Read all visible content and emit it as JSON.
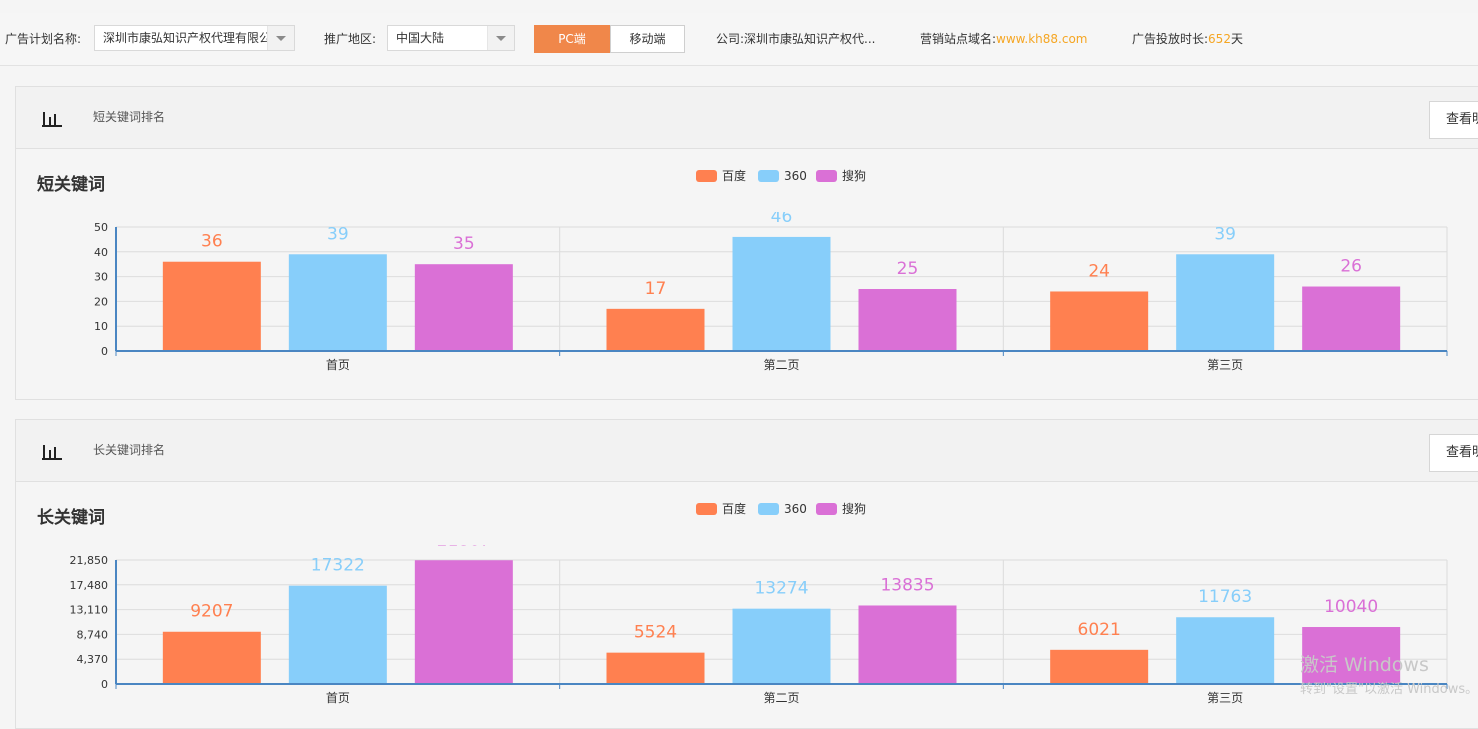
{
  "filters": {
    "plan_label": "广告计划名称:",
    "plan_value": "深圳市康弘知识产权代理有限公司",
    "region_label": "推广地区:",
    "region_value": "中国大陆",
    "device_pc": "PC端",
    "device_mobile": "移动端",
    "company_label": "公司:",
    "company_value": "深圳市康弘知识产权代...",
    "domain_label": "营销站点域名:",
    "domain_value": "www.kh88.com",
    "duration_label": "广告投放时长:",
    "duration_value": "652",
    "duration_unit": "天"
  },
  "panels": [
    {
      "title": "短关键词排名",
      "button": "查看明细",
      "chart_title": "短关键词"
    },
    {
      "title": "长关键词排名",
      "button": "查看明细",
      "chart_title": "长关键词"
    }
  ],
  "colors": {
    "baidu": "#ff8050",
    "s360": "#87cefa",
    "sogou": "#da70d6",
    "accent": "#f0874a"
  },
  "chart_data": [
    {
      "type": "bar",
      "categories": [
        "首页",
        "第二页",
        "第三页"
      ],
      "series": [
        {
          "name": "百度",
          "values": [
            36,
            17,
            24
          ]
        },
        {
          "name": "360",
          "values": [
            39,
            46,
            39
          ]
        },
        {
          "name": "搜狗",
          "values": [
            35,
            25,
            26
          ]
        }
      ],
      "yticks": [
        "0",
        "10",
        "20",
        "30",
        "40",
        "50"
      ],
      "ylim": [
        0,
        50
      ],
      "legend": "top-center",
      "grid": true
    },
    {
      "type": "bar",
      "categories": [
        "首页",
        "第二页",
        "第三页"
      ],
      "series": [
        {
          "name": "百度",
          "values": [
            9207,
            5524,
            6021
          ]
        },
        {
          "name": "360",
          "values": [
            17322,
            13274,
            11763
          ]
        },
        {
          "name": "搜狗",
          "values": [
            21807,
            13835,
            10040
          ]
        }
      ],
      "yticks": [
        "0",
        "4,370",
        "8,740",
        "13,110",
        "17,480",
        "21,850"
      ],
      "ylim": [
        0,
        21850
      ],
      "legend": "top-center",
      "grid": true
    }
  ],
  "watermark": {
    "line1": "激活 Windows",
    "line2": "转到\"设置\"以激活 Windows。"
  }
}
